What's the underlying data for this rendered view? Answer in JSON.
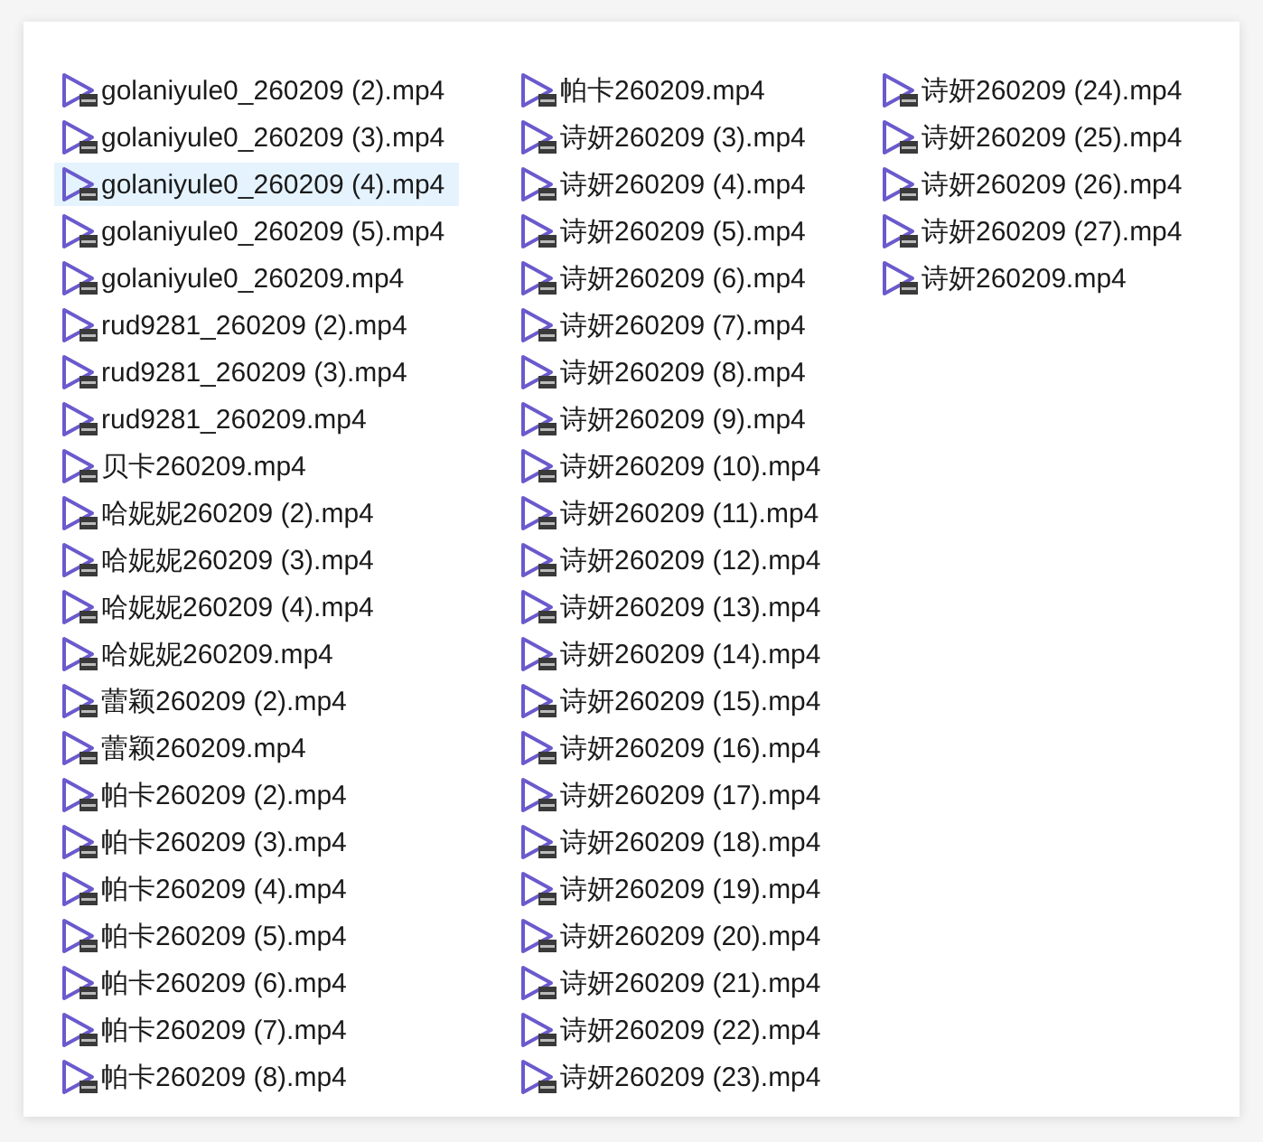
{
  "files": [
    {
      "name": "golaniyule0_260209 (2).mp4",
      "selected": false
    },
    {
      "name": "golaniyule0_260209 (3).mp4",
      "selected": false
    },
    {
      "name": "golaniyule0_260209 (4).mp4",
      "selected": true
    },
    {
      "name": "golaniyule0_260209 (5).mp4",
      "selected": false
    },
    {
      "name": "golaniyule0_260209.mp4",
      "selected": false
    },
    {
      "name": "rud9281_260209 (2).mp4",
      "selected": false
    },
    {
      "name": "rud9281_260209 (3).mp4",
      "selected": false
    },
    {
      "name": "rud9281_260209.mp4",
      "selected": false
    },
    {
      "name": "贝卡260209.mp4",
      "selected": false
    },
    {
      "name": "哈妮妮260209 (2).mp4",
      "selected": false
    },
    {
      "name": "哈妮妮260209 (3).mp4",
      "selected": false
    },
    {
      "name": "哈妮妮260209 (4).mp4",
      "selected": false
    },
    {
      "name": "哈妮妮260209.mp4",
      "selected": false
    },
    {
      "name": "蕾颖260209 (2).mp4",
      "selected": false
    },
    {
      "name": "蕾颖260209.mp4",
      "selected": false
    },
    {
      "name": "帕卡260209 (2).mp4",
      "selected": false
    },
    {
      "name": "帕卡260209 (3).mp4",
      "selected": false
    },
    {
      "name": "帕卡260209 (4).mp4",
      "selected": false
    },
    {
      "name": "帕卡260209 (5).mp4",
      "selected": false
    },
    {
      "name": "帕卡260209 (6).mp4",
      "selected": false
    },
    {
      "name": "帕卡260209 (7).mp4",
      "selected": false
    },
    {
      "name": "帕卡260209 (8).mp4",
      "selected": false
    },
    {
      "name": "帕卡260209.mp4",
      "selected": false
    },
    {
      "name": "诗妍260209 (3).mp4",
      "selected": false
    },
    {
      "name": "诗妍260209 (4).mp4",
      "selected": false
    },
    {
      "name": "诗妍260209 (5).mp4",
      "selected": false
    },
    {
      "name": "诗妍260209 (6).mp4",
      "selected": false
    },
    {
      "name": "诗妍260209 (7).mp4",
      "selected": false
    },
    {
      "name": "诗妍260209 (8).mp4",
      "selected": false
    },
    {
      "name": "诗妍260209 (9).mp4",
      "selected": false
    },
    {
      "name": "诗妍260209 (10).mp4",
      "selected": false
    },
    {
      "name": "诗妍260209 (11).mp4",
      "selected": false
    },
    {
      "name": "诗妍260209 (12).mp4",
      "selected": false
    },
    {
      "name": "诗妍260209 (13).mp4",
      "selected": false
    },
    {
      "name": "诗妍260209 (14).mp4",
      "selected": false
    },
    {
      "name": "诗妍260209 (15).mp4",
      "selected": false
    },
    {
      "name": "诗妍260209 (16).mp4",
      "selected": false
    },
    {
      "name": "诗妍260209 (17).mp4",
      "selected": false
    },
    {
      "name": "诗妍260209 (18).mp4",
      "selected": false
    },
    {
      "name": "诗妍260209 (19).mp4",
      "selected": false
    },
    {
      "name": "诗妍260209 (20).mp4",
      "selected": false
    },
    {
      "name": "诗妍260209 (21).mp4",
      "selected": false
    },
    {
      "name": "诗妍260209 (22).mp4",
      "selected": false
    },
    {
      "name": "诗妍260209 (23).mp4",
      "selected": false
    },
    {
      "name": "诗妍260209 (24).mp4",
      "selected": false
    },
    {
      "name": "诗妍260209 (25).mp4",
      "selected": false
    },
    {
      "name": "诗妍260209 (26).mp4",
      "selected": false
    },
    {
      "name": "诗妍260209 (27).mp4",
      "selected": false
    },
    {
      "name": "诗妍260209.mp4",
      "selected": false
    }
  ]
}
